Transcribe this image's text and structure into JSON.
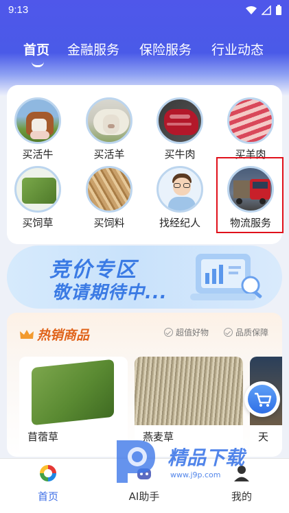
{
  "status_bar": {
    "time": "9:13"
  },
  "top_tabs": [
    {
      "label": "首页",
      "active": true
    },
    {
      "label": "金融服务",
      "active": false
    },
    {
      "label": "保险服务",
      "active": false
    },
    {
      "label": "行业动态",
      "active": false
    }
  ],
  "categories": [
    {
      "label": "买活牛",
      "icon": "cattle-photo"
    },
    {
      "label": "买活羊",
      "icon": "sheep-photo"
    },
    {
      "label": "买牛肉",
      "icon": "beef-photo"
    },
    {
      "label": "买羊肉",
      "icon": "lamb-slices-photo"
    },
    {
      "label": "买饲草",
      "icon": "hay-bale-photo"
    },
    {
      "label": "买饲料",
      "icon": "feed-pellets-photo"
    },
    {
      "label": "找经纪人",
      "icon": "broker-avatar"
    },
    {
      "label": "物流服务",
      "icon": "truck-photo"
    }
  ],
  "banner": {
    "title": "竞价专区",
    "subtitle": "敬请期待中..."
  },
  "hot": {
    "title": "热销商品",
    "tags": [
      "超值好物",
      "品质保障"
    ],
    "products": [
      {
        "name": "苜蓿草"
      },
      {
        "name": "燕麦草"
      },
      {
        "name": "天"
      }
    ]
  },
  "bottom_nav": [
    {
      "label": "首页",
      "active": true
    },
    {
      "label": "AI助手",
      "active": false
    },
    {
      "label": "我的",
      "active": false
    }
  ],
  "watermark": {
    "text": "精品下载",
    "url": "www.j9p.com"
  },
  "colors": {
    "header": "#4f57ea",
    "accent": "#3d6ee6",
    "hot_title": "#e0631a",
    "highlight": "#e0101a"
  }
}
